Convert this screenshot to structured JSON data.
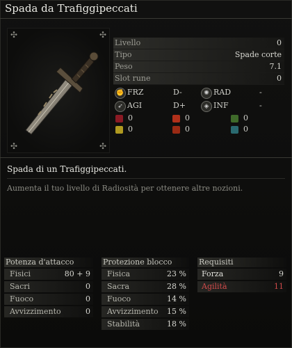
{
  "title": "Spada da Trafiggipeccati",
  "stats": [
    {
      "label": "Livello",
      "value": "0"
    },
    {
      "label": "Tipo",
      "value": "Spade corte"
    },
    {
      "label": "Peso",
      "value": "7.1"
    },
    {
      "label": "Slot rune",
      "value": "0"
    }
  ],
  "scaling": [
    {
      "icon": "strength-icon",
      "label": "FRZ",
      "grade": "D-"
    },
    {
      "icon": "radiance-icon",
      "label": "RAD",
      "grade": "-"
    },
    {
      "icon": "agility-icon",
      "label": "AGI",
      "grade": "D+"
    },
    {
      "icon": "influence-icon",
      "label": "INF",
      "grade": "-"
    }
  ],
  "affinities": [
    {
      "icon": "bleed-icon",
      "color": "#8b1a24",
      "value": "0"
    },
    {
      "icon": "fire-rune-icon",
      "color": "#b0301a",
      "value": "0"
    },
    {
      "icon": "poison-icon",
      "color": "#3f6a2a",
      "value": "0"
    },
    {
      "icon": "light-icon",
      "color": "#b09a20",
      "value": "0"
    },
    {
      "icon": "flame-icon",
      "color": "#9a2a14",
      "value": "0"
    },
    {
      "icon": "frost-icon",
      "color": "#2a6a70",
      "value": "0"
    }
  ],
  "description": {
    "title": "Spada di un Trafiggipeccati.",
    "text": "Aumenta il tuo livello di Radiosità per ottenere altre nozioni."
  },
  "attack": {
    "header": "Potenza d'attacco",
    "rows": [
      {
        "label": "Fisici",
        "value": "80 +  9"
      },
      {
        "label": "Sacri",
        "value": "0"
      },
      {
        "label": "Fuoco",
        "value": "0"
      },
      {
        "label": "Avvizzimento",
        "value": "0"
      }
    ]
  },
  "guard": {
    "header": "Protezione blocco",
    "rows": [
      {
        "label": "Fisica",
        "value": "23 %"
      },
      {
        "label": "Sacra",
        "value": "28 %"
      },
      {
        "label": "Fuoco",
        "value": "14 %"
      },
      {
        "label": "Avvizzimento",
        "value": "15 %"
      },
      {
        "label": "Stabilità",
        "value": "18 %"
      }
    ]
  },
  "requirements": {
    "header": "Requisiti",
    "rows": [
      {
        "label": "Forza",
        "value": "9",
        "color": "#d8d8d2"
      },
      {
        "label": "Agilità",
        "value": "11",
        "color": "#d14a4a"
      }
    ]
  }
}
